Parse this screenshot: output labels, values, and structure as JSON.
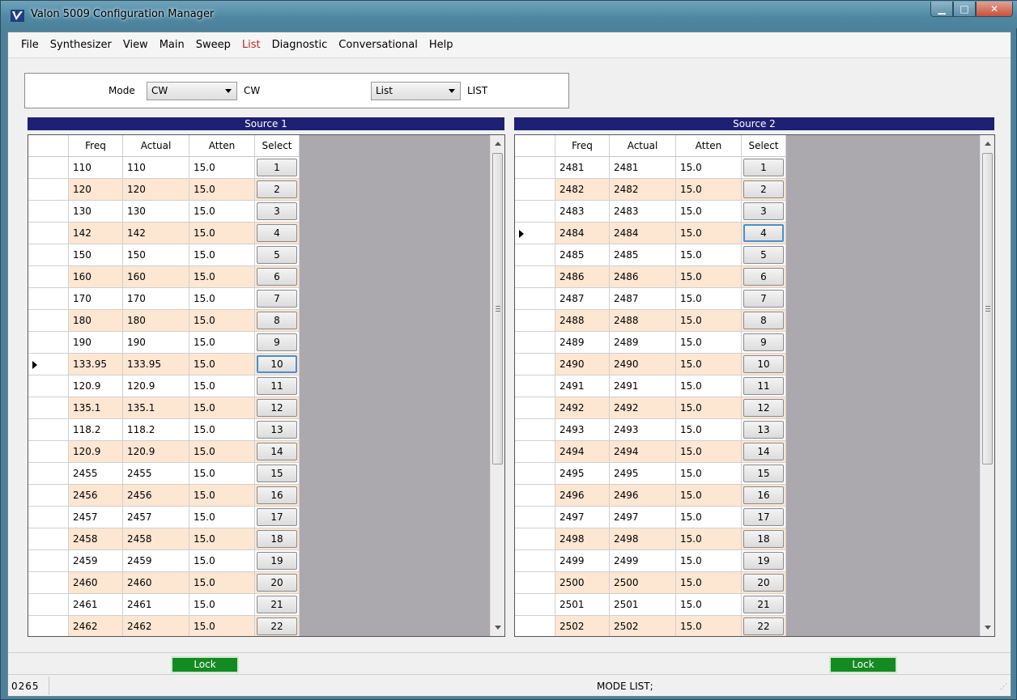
{
  "window": {
    "title": "Valon 5009 Configuration Manager"
  },
  "menu": [
    {
      "label": "File",
      "active": false
    },
    {
      "label": "Synthesizer",
      "active": false
    },
    {
      "label": "View",
      "active": false
    },
    {
      "label": "Main",
      "active": false
    },
    {
      "label": "Sweep",
      "active": false
    },
    {
      "label": "List",
      "active": true
    },
    {
      "label": "Diagnostic",
      "active": false
    },
    {
      "label": "Conversational",
      "active": false
    },
    {
      "label": "Help",
      "active": false
    }
  ],
  "mode": {
    "label": "Mode",
    "mode_value": "CW",
    "mode_text": "CW",
    "list_value": "List",
    "list_text": "LIST"
  },
  "columns": [
    "Freq",
    "Actual",
    "Atten",
    "Select"
  ],
  "source1": {
    "title": "Source 1",
    "current_row": 9,
    "rows": [
      [
        "110",
        "110",
        "15.0",
        "1"
      ],
      [
        "120",
        "120",
        "15.0",
        "2"
      ],
      [
        "130",
        "130",
        "15.0",
        "3"
      ],
      [
        "142",
        "142",
        "15.0",
        "4"
      ],
      [
        "150",
        "150",
        "15.0",
        "5"
      ],
      [
        "160",
        "160",
        "15.0",
        "6"
      ],
      [
        "170",
        "170",
        "15.0",
        "7"
      ],
      [
        "180",
        "180",
        "15.0",
        "8"
      ],
      [
        "190",
        "190",
        "15.0",
        "9"
      ],
      [
        "133.95",
        "133.95",
        "15.0",
        "10"
      ],
      [
        "120.9",
        "120.9",
        "15.0",
        "11"
      ],
      [
        "135.1",
        "135.1",
        "15.0",
        "12"
      ],
      [
        "118.2",
        "118.2",
        "15.0",
        "13"
      ],
      [
        "120.9",
        "120.9",
        "15.0",
        "14"
      ],
      [
        "2455",
        "2455",
        "15.0",
        "15"
      ],
      [
        "2456",
        "2456",
        "15.0",
        "16"
      ],
      [
        "2457",
        "2457",
        "15.0",
        "17"
      ],
      [
        "2458",
        "2458",
        "15.0",
        "18"
      ],
      [
        "2459",
        "2459",
        "15.0",
        "19"
      ],
      [
        "2460",
        "2460",
        "15.0",
        "20"
      ],
      [
        "2461",
        "2461",
        "15.0",
        "21"
      ],
      [
        "2462",
        "2462",
        "15.0",
        "22"
      ]
    ]
  },
  "source2": {
    "title": "Source 2",
    "current_row": 3,
    "rows": [
      [
        "2481",
        "2481",
        "15.0",
        "1"
      ],
      [
        "2482",
        "2482",
        "15.0",
        "2"
      ],
      [
        "2483",
        "2483",
        "15.0",
        "3"
      ],
      [
        "2484",
        "2484",
        "15.0",
        "4"
      ],
      [
        "2485",
        "2485",
        "15.0",
        "5"
      ],
      [
        "2486",
        "2486",
        "15.0",
        "6"
      ],
      [
        "2487",
        "2487",
        "15.0",
        "7"
      ],
      [
        "2488",
        "2488",
        "15.0",
        "8"
      ],
      [
        "2489",
        "2489",
        "15.0",
        "9"
      ],
      [
        "2490",
        "2490",
        "15.0",
        "10"
      ],
      [
        "2491",
        "2491",
        "15.0",
        "11"
      ],
      [
        "2492",
        "2492",
        "15.0",
        "12"
      ],
      [
        "2493",
        "2493",
        "15.0",
        "13"
      ],
      [
        "2494",
        "2494",
        "15.0",
        "14"
      ],
      [
        "2495",
        "2495",
        "15.0",
        "15"
      ],
      [
        "2496",
        "2496",
        "15.0",
        "16"
      ],
      [
        "2497",
        "2497",
        "15.0",
        "17"
      ],
      [
        "2498",
        "2498",
        "15.0",
        "18"
      ],
      [
        "2499",
        "2499",
        "15.0",
        "19"
      ],
      [
        "2500",
        "2500",
        "15.0",
        "20"
      ],
      [
        "2501",
        "2501",
        "15.0",
        "21"
      ],
      [
        "2502",
        "2502",
        "15.0",
        "22"
      ]
    ]
  },
  "lock": {
    "source1": "Lock",
    "source2": "Lock"
  },
  "status": {
    "left": "0265",
    "right": "MODE LIST;"
  },
  "colors": {
    "header_bar": "#1d2073",
    "row_alt": "#fde6d2",
    "lock_green": "#148a22",
    "active_menu": "#c0282d"
  }
}
